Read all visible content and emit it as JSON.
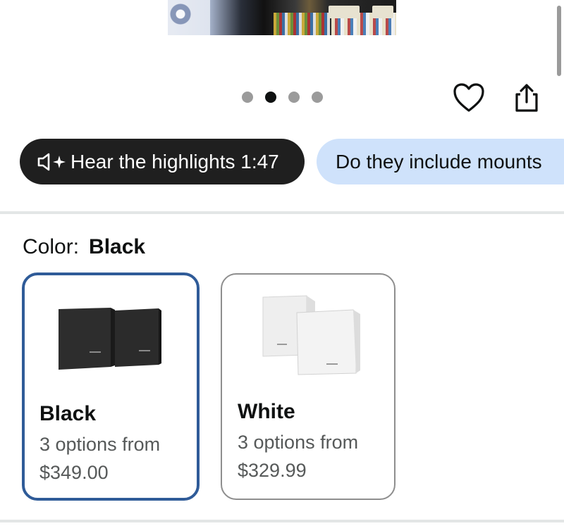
{
  "carousel": {
    "dots": [
      {
        "active": false
      },
      {
        "active": true
      },
      {
        "active": false
      },
      {
        "active": false
      }
    ]
  },
  "icons": {
    "heart": "heart-icon",
    "share": "share-icon",
    "speaker": "speaker-sparkle-icon"
  },
  "pills": {
    "highlights_label": "Hear the highlights 1:47",
    "question_label": "Do they include mounts"
  },
  "color": {
    "label": "Color:",
    "selected": "Black",
    "options": [
      {
        "name": "Black",
        "subtitle": "3 options from",
        "price": "$349.00"
      },
      {
        "name": "White",
        "subtitle": "3 options from",
        "price": "$329.99"
      }
    ]
  },
  "colors": {
    "selected_border": "#2f5b98",
    "pill_dark": "#1f1f1f",
    "pill_light": "#cfe2fb"
  }
}
